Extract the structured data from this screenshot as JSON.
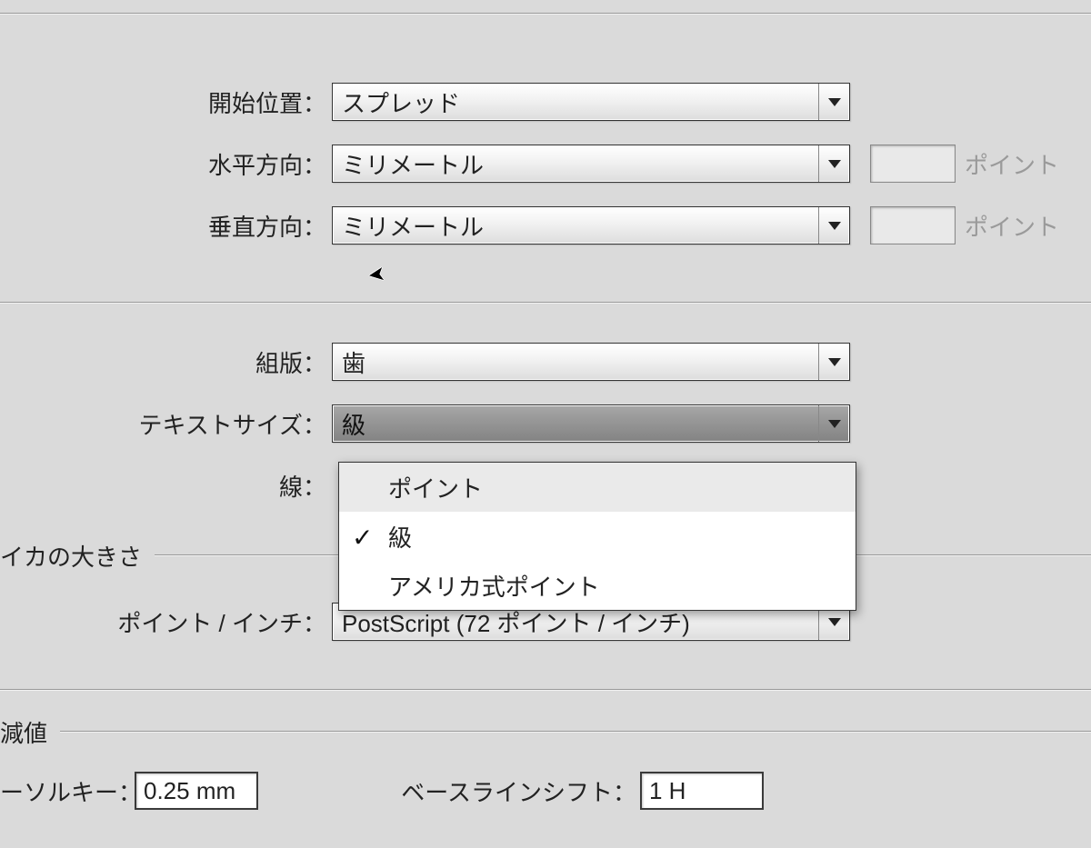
{
  "rows": {
    "start_position": {
      "label": "開始位置：",
      "value": "スプレッド"
    },
    "horizontal": {
      "label": "水平方向：",
      "value": "ミリメートル",
      "suffix": "ポイント"
    },
    "vertical": {
      "label": "垂直方向：",
      "value": "ミリメートル",
      "suffix": "ポイント"
    },
    "typesetting": {
      "label": "組版：",
      "value": "歯"
    },
    "text_size": {
      "label": "テキストサイズ：",
      "value": "級"
    },
    "line": {
      "label": "線："
    },
    "points_per_inch": {
      "label": "ポイント / インチ：",
      "value": "PostScript (72 ポイント / インチ)"
    }
  },
  "dropdown": {
    "options": [
      {
        "label": "ポイント",
        "selected": false,
        "hover": true
      },
      {
        "label": "級",
        "selected": true,
        "hover": false
      },
      {
        "label": "アメリカ式ポイント",
        "selected": false,
        "hover": false
      }
    ]
  },
  "sections": {
    "size_section": "イカの大きさ",
    "decrement_section": "減値"
  },
  "bottom": {
    "cursor_key_label": "ーソルキー：",
    "cursor_key_value": "0.25 mm",
    "baseline_shift_label": "ベースラインシフト：",
    "baseline_shift_value": "1 H"
  }
}
